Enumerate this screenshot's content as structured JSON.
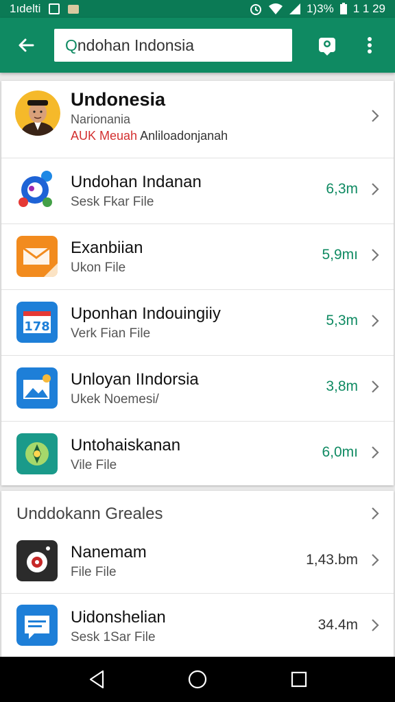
{
  "status_bar": {
    "left_text": "1ıdelti",
    "right_pct": "1)3%",
    "time": "1 1 29"
  },
  "search": {
    "value": "ndohan Indonsia",
    "prefix": "Q"
  },
  "profile": {
    "title": "Undonesia",
    "subtitle": "Narionania",
    "red_part": "AUK Meuah",
    "dark_part": " Anliloadonjanah"
  },
  "apps": [
    {
      "title": "Undohan Indanan",
      "sub": "Sesk Fkar File",
      "size": "6,3m"
    },
    {
      "title": "Exanbiian",
      "sub": "Ukon File",
      "size": "5,9mı"
    },
    {
      "title": "Uponhan Indouingiiy",
      "sub": "Verk Fian File",
      "size": "5,3m"
    },
    {
      "title": "Unloyan IIndorsia",
      "sub": "Ukek Noemesi/",
      "size": "3,8m"
    },
    {
      "title": "Untohaiskanan",
      "sub": "Vile File",
      "size": "6,0mı"
    }
  ],
  "section": {
    "header": "Unddokann Greales",
    "items": [
      {
        "title": "Nanemam",
        "sub": "File File",
        "size": "1,43.bm"
      },
      {
        "title": "Uidonshelian",
        "sub": "Sesk 1Sar File",
        "size": "34.4m"
      }
    ]
  },
  "icon_colors": {
    "accent": "#0f8a62",
    "status_bar": "#0b7a55",
    "size_text": "#0f8a62",
    "subtitle_red": "#d32f2f"
  }
}
